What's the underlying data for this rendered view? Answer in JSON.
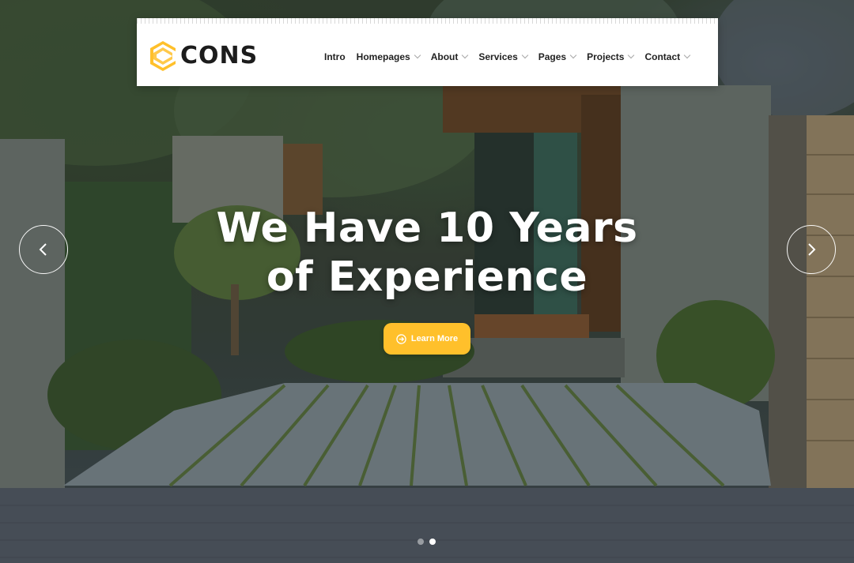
{
  "brand": {
    "name": "CONS",
    "accent": "#ffc02b",
    "logo_icon": "cons-logo-icon"
  },
  "nav": {
    "items": [
      {
        "label": "Intro",
        "has_dropdown": false
      },
      {
        "label": "Homepages",
        "has_dropdown": true
      },
      {
        "label": "About",
        "has_dropdown": true
      },
      {
        "label": "Services",
        "has_dropdown": true
      },
      {
        "label": "Pages",
        "has_dropdown": true
      },
      {
        "label": "Projects",
        "has_dropdown": true
      },
      {
        "label": "Contact",
        "has_dropdown": true
      }
    ]
  },
  "hero": {
    "headline_line1": "We Have 10 Years",
    "headline_line2": "of Experience",
    "cta_label": "Learn More",
    "cta_icon": "arrow-circle-right-icon",
    "prev_icon": "chevron-left-icon",
    "next_icon": "chevron-right-icon"
  },
  "slider": {
    "slide_count": 2,
    "active_index": 1
  }
}
